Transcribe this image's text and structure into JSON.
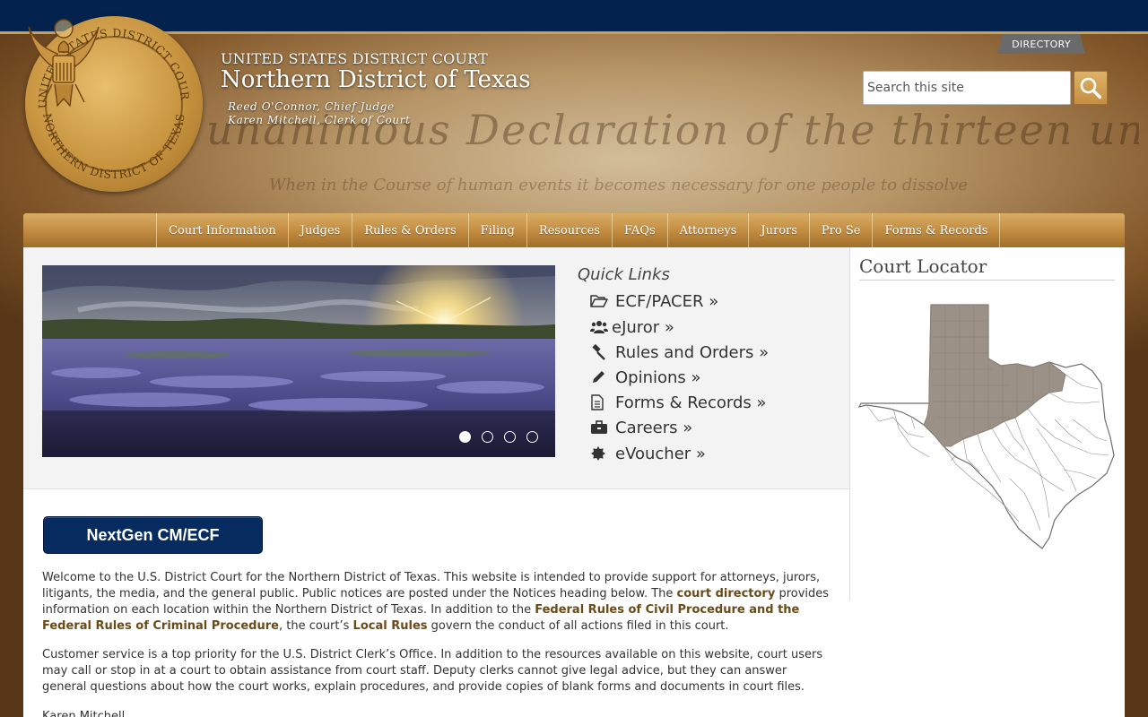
{
  "header": {
    "court_super": "UNITED STATES DISTRICT COURT",
    "court_title": "Northern District of Texas",
    "chief_judge": "Reed O'Connor, Chief Judge",
    "clerk": "Karen Mitchell, Clerk of Court",
    "seal_top_text": "UNITED STATES DISTRICT COURT",
    "seal_bottom_text": "NORTHERN DISTRICT OF TEXAS",
    "directory_label": "DIRECTORY",
    "search_placeholder": "Search this site",
    "search_icon": "magnifier-icon"
  },
  "nav": {
    "items": [
      "Court Information",
      "Judges",
      "Rules & Orders",
      "Filing",
      "Resources",
      "FAQs",
      "Attorneys",
      "Jurors",
      "Pro Se",
      "Forms & Records"
    ]
  },
  "carousel": {
    "slide_count": 4,
    "active_index": 0
  },
  "quick_links": {
    "title": "Quick Links",
    "items": [
      {
        "label": "ECF/PACER »",
        "icon": "folder-open-icon"
      },
      {
        "label": "eJuror »",
        "icon": "users-icon"
      },
      {
        "label": "Rules and Orders »",
        "icon": "gavel-icon"
      },
      {
        "label": "Opinions »",
        "icon": "pencil-icon"
      },
      {
        "label": "Forms & Records »",
        "icon": "document-icon"
      },
      {
        "label": "Careers »",
        "icon": "briefcase-icon"
      },
      {
        "label": "eVoucher »",
        "icon": "certificate-icon"
      }
    ]
  },
  "court_locator": {
    "title": "Court Locator"
  },
  "nextgen": {
    "label": "NextGen CM/ECF"
  },
  "body": {
    "p1_a": "Welcome to the U.S. District Court for the Northern District of Texas. This website is intended to provide support for attorneys, jurors, litigants, the media, and the general public. Public notices are posted under the Notices heading below. The ",
    "p1_link1": "court directory",
    "p1_b": " provides information on each location within the Northern District of Texas. In addition to the ",
    "p1_link2": "Federal Rules of Civil Procedure and the Federal Rules of Criminal Procedure",
    "p1_c": ", the court’s ",
    "p1_link3": "Local Rules",
    "p1_d": " govern the conduct of all actions filed in this court.",
    "p2": "Customer service is a top priority for the U.S. District Clerk’s Office. In addition to the resources available on this website, court users may call or stop in at a court to obtain assistance from court staff. Deputy clerks cannot give legal advice, but they can answer general questions about how the court works, explain procedures, and provide copies of blank forms and documents in court files.",
    "signature": "Karen Mitchell"
  },
  "colors": {
    "top_bar": "#03234e",
    "gold": "#c8943f",
    "nextgen": "#062b5f",
    "link": "#6a4a17",
    "district_fill": "#9c9186"
  }
}
